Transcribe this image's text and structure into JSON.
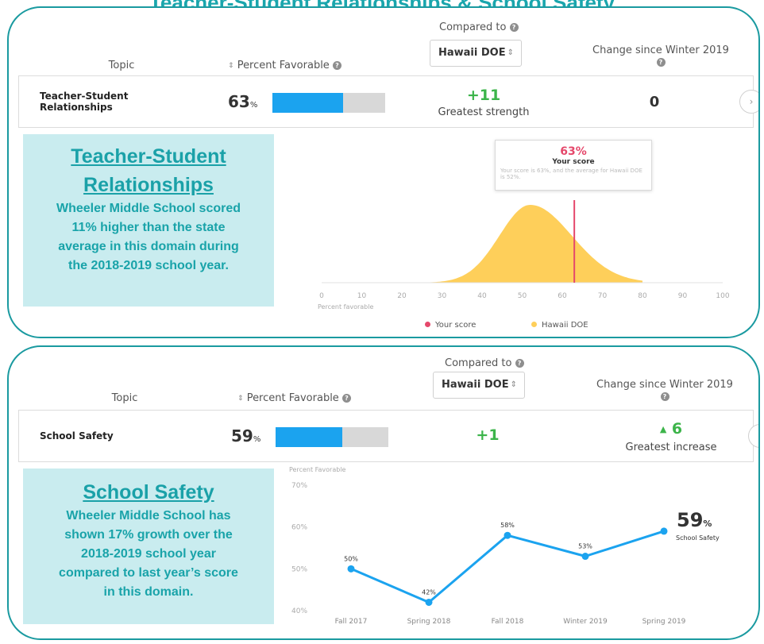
{
  "page_title": "Teacher-Student Relationships & School Safety",
  "colors": {
    "accent": "#1aa6ad",
    "bar_fill": "#1ba3ef",
    "positive": "#3cb44a",
    "your_score": "#e5486b",
    "distribution": "#fecf5a"
  },
  "header": {
    "topic": "Topic",
    "percent_favorable": "Percent Favorable",
    "compared_to": "Compared to",
    "compared_value": "Hawaii DOE",
    "change_since": "Change since Winter 2019"
  },
  "panel1": {
    "row": {
      "name_line1": "Teacher-Student",
      "name_line2": "Relationships",
      "percent": "63",
      "percent_unit": "%",
      "fill_fraction": 0.63,
      "delta": "+11",
      "delta_label": "Greatest strength",
      "change": "0"
    },
    "callout": {
      "title_line1": "Teacher-Student",
      "title_line2": "Relationships",
      "body": [
        "Wheeler Middle School scored",
        "11% higher than the state",
        "average in this domain during",
        "the 2018-2019 school year."
      ]
    },
    "tooltip": {
      "score": "63%",
      "label": "Your score",
      "detail": "Your score is 63%, and the average for Hawaii DOE is 52%."
    },
    "legend": {
      "your_score": "Your score",
      "comparison": "Hawaii DOE"
    }
  },
  "panel2": {
    "row": {
      "name": "School Safety",
      "percent": "59",
      "percent_unit": "%",
      "fill_fraction": 0.59,
      "delta": "+1",
      "change_arrow": "▲",
      "change": "6",
      "change_label": "Greatest increase"
    },
    "callout": {
      "title": "School Safety",
      "body": [
        "Wheeler Middle School has",
        "shown 17% growth over the",
        "2018-2019 school year",
        "compared to last year’s score",
        "in this domain."
      ]
    },
    "big_score": "59",
    "big_score_unit": "%",
    "big_score_label": "School Safety"
  },
  "chart_data": [
    {
      "type": "area",
      "xlabel": "Percent favorable",
      "xlim": [
        0,
        100
      ],
      "xticks": [
        "0",
        "10",
        "20",
        "30",
        "40",
        "50",
        "60",
        "70",
        "80",
        "90",
        "100"
      ],
      "series": [
        {
          "name": "Hawaii DOE",
          "distribution": "normal",
          "mean": 52,
          "sd": 9
        },
        {
          "name": "Your score",
          "value": 63
        }
      ],
      "legend_position": "bottom"
    },
    {
      "type": "line",
      "ylabel": "Percent Favorable",
      "ylim": [
        40,
        70
      ],
      "yticks": [
        "40%",
        "50%",
        "60%",
        "70%"
      ],
      "categories": [
        "Fall 2017",
        "Spring 2018",
        "Fall 2018",
        "Winter 2019",
        "Spring 2019"
      ],
      "values": [
        50,
        42,
        58,
        53,
        59
      ],
      "data_labels": [
        "50%",
        "42%",
        "58%",
        "53%",
        ""
      ]
    }
  ]
}
